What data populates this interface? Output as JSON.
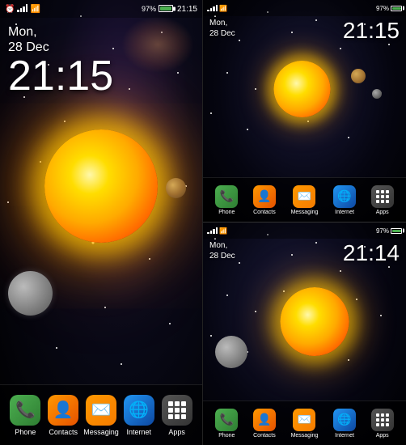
{
  "left": {
    "status": {
      "alarm": "⏰",
      "wifi": "📶",
      "battery_pct": "97%",
      "time": "21:15"
    },
    "date_line1": "Mon,",
    "date_line2": "28 Dec",
    "clock": "21:15",
    "dock": [
      {
        "id": "phone",
        "label": "Phone",
        "emoji": "📞",
        "color": "#3E9C3E"
      },
      {
        "id": "contacts",
        "label": "Contacts",
        "emoji": "👤",
        "color": "#E8700A"
      },
      {
        "id": "messaging",
        "label": "Messaging",
        "emoji": "✉️",
        "color": "#F08A00"
      },
      {
        "id": "internet",
        "label": "Internet",
        "emoji": "🌐",
        "color": "#1E7ED4"
      },
      {
        "id": "apps",
        "label": "Apps",
        "emoji": "⊞",
        "color": "#444"
      }
    ]
  },
  "right_top": {
    "status": {
      "battery_pct": "97%",
      "time_status": "21:15"
    },
    "date_line1": "Mon,",
    "date_line2": "28 Dec",
    "clock": "21:15",
    "dock": [
      {
        "id": "phone",
        "label": "Phone",
        "emoji": "📞"
      },
      {
        "id": "contacts",
        "label": "Contacts",
        "emoji": "👤"
      },
      {
        "id": "messaging",
        "label": "Messaging",
        "emoji": "✉️"
      },
      {
        "id": "internet",
        "label": "Internet",
        "emoji": "🌐"
      },
      {
        "id": "apps",
        "label": "Apps",
        "emoji": "⊞"
      }
    ]
  },
  "right_bottom": {
    "date_line1": "Mon,",
    "date_line2": "28 Dec",
    "clock": "21:14",
    "dock": [
      {
        "id": "phone",
        "label": "Phone",
        "emoji": "📞"
      },
      {
        "id": "contacts",
        "label": "Contacts",
        "emoji": "👤"
      },
      {
        "id": "messaging",
        "label": "Messaging",
        "emoji": "✉️"
      },
      {
        "id": "internet",
        "label": "Internet",
        "emoji": "🌐"
      },
      {
        "id": "apps",
        "label": "Apps",
        "emoji": "⊞"
      }
    ]
  }
}
